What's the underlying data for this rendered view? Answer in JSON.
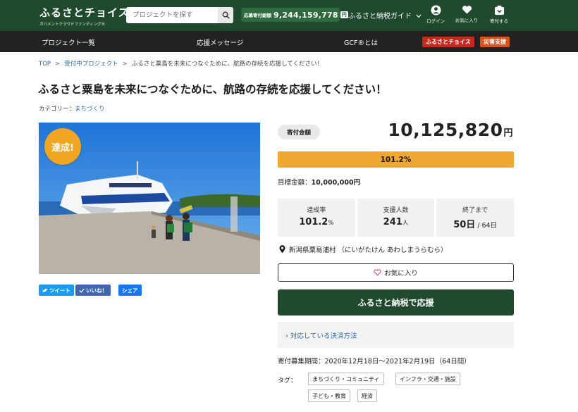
{
  "header": {
    "logo_main": "ふるさとチョイス",
    "logo_sub": "ガバメントクラウドファンディング®",
    "search_placeholder": "プロジェクトを探す",
    "total_label": "応募寄付総額",
    "total_value": "9,244,159,778",
    "total_unit": "円",
    "guide": "ふるさと納税ガイド",
    "icons": [
      {
        "label": "ログイン",
        "icon": "user-icon"
      },
      {
        "label": "お気に入り",
        "icon": "heart-icon"
      },
      {
        "label": "寄付する",
        "icon": "donate-icon"
      }
    ]
  },
  "nav": {
    "items": [
      "プロジェクト一覧",
      "応援メッセージ",
      "GCF®とは"
    ],
    "badges": [
      {
        "label": "ふるさとチョイス",
        "color": "#c8281e"
      },
      {
        "label": "災害支援",
        "color": "#d9531e"
      }
    ]
  },
  "breadcrumb": [
    "TOP",
    "受付中プロジェクト",
    "ふるさと粟島を未来につなぐために、航路の存続を応援してください！"
  ],
  "title": "ふるさと粟島を未来につなぐために、航路の存続を応援してください！",
  "category": {
    "label": "カテゴリー：",
    "value": "まちづくり"
  },
  "photo": {
    "badge": "達成!"
  },
  "sns": [
    "ツイート",
    "いいね！",
    "シェア"
  ],
  "donation": {
    "label": "寄付金額",
    "amount": "10,125,820",
    "unit": "円",
    "progress": "101.2%",
    "goal_label": "目標金額：",
    "goal_value": "10,000,000円"
  },
  "stats": [
    {
      "label": "達成率",
      "value": "101.2",
      "unit": "%"
    },
    {
      "label": "支援人数",
      "value": "241",
      "unit": "人"
    },
    {
      "label": "終了まで",
      "value": "50日",
      "unit": " / 64日"
    }
  ],
  "location": "新潟県粟島浦村 （にいがたけん あわしまうらむら）",
  "favorite": "お気に入り",
  "cta": "ふるさと納税で応援",
  "payment": "› 対応している決済方法",
  "period": "寄付募集期間：2020年12月18日～2021年2月19日（64日間）",
  "tags_label": "タグ：",
  "tags": [
    "まちづくり・コミュニティ",
    "インフラ・交通・施設",
    "子ども・教育",
    "経済"
  ],
  "colors": {
    "brand": "#1f4a2e",
    "accent": "#f1a833",
    "link": "#2a6bb0"
  }
}
